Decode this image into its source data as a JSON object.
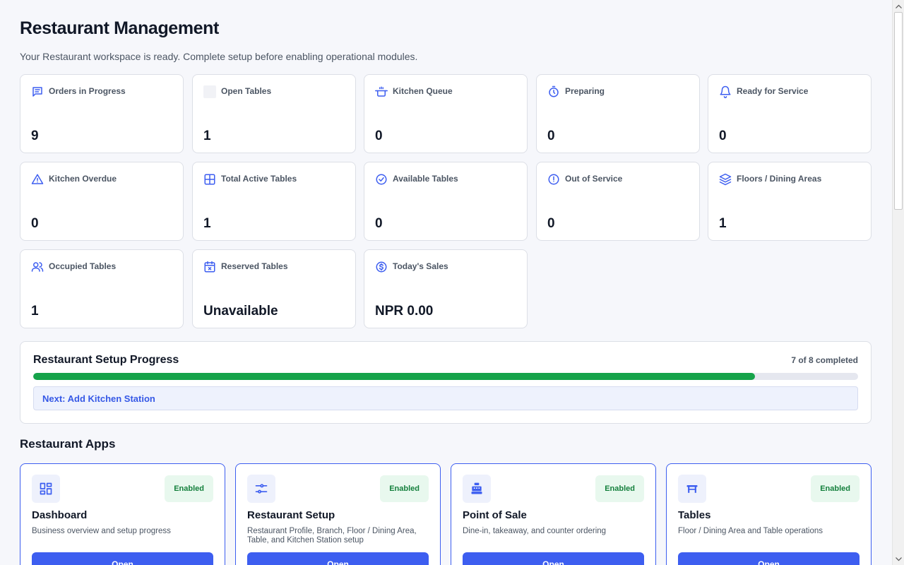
{
  "page": {
    "title": "Restaurant Management",
    "subtitle": "Your Restaurant workspace is ready. Complete setup before enabling operational modules."
  },
  "stats": [
    {
      "icon": "message-list-icon",
      "label": "Orders in Progress",
      "value": "9"
    },
    {
      "icon": "blank-icon",
      "label": "Open Tables",
      "value": "1"
    },
    {
      "icon": "cooking-pot-icon",
      "label": "Kitchen Queue",
      "value": "0"
    },
    {
      "icon": "stopwatch-icon",
      "label": "Preparing",
      "value": "0"
    },
    {
      "icon": "bell-icon",
      "label": "Ready for Service",
      "value": "0"
    },
    {
      "icon": "warning-triangle-icon",
      "label": "Kitchen Overdue",
      "value": "0"
    },
    {
      "icon": "grid-icon",
      "label": "Total Active Tables",
      "value": "1"
    },
    {
      "icon": "check-circle-icon",
      "label": "Available Tables",
      "value": "0"
    },
    {
      "icon": "alert-circle-icon",
      "label": "Out of Service",
      "value": "0"
    },
    {
      "icon": "layers-icon",
      "label": "Floors / Dining Areas",
      "value": "1"
    },
    {
      "icon": "users-icon",
      "label": "Occupied Tables",
      "value": "1"
    },
    {
      "icon": "calendar-x-icon",
      "label": "Reserved Tables",
      "value": "Unavailable"
    },
    {
      "icon": "dollar-circle-icon",
      "label": "Today's Sales",
      "value": "NPR 0.00"
    }
  ],
  "setup_progress": {
    "title": "Restaurant Setup Progress",
    "count_text": "7 of 8 completed",
    "completed": 7,
    "total": 8,
    "next_label": "Next: Add Kitchen Station"
  },
  "apps_section": {
    "title": "Restaurant Apps",
    "apps": [
      {
        "icon": "dashboard-icon",
        "name": "Dashboard",
        "badge": "Enabled",
        "description": "Business overview and setup progress",
        "button": "Open"
      },
      {
        "icon": "sliders-icon",
        "name": "Restaurant Setup",
        "badge": "Enabled",
        "description": "Restaurant Profile, Branch, Floor / Dining Area, Table, and Kitchen Station setup",
        "button": "Open"
      },
      {
        "icon": "cash-register-icon",
        "name": "Point of Sale",
        "badge": "Enabled",
        "description": "Dine-in, takeaway, and counter ordering",
        "button": "Open"
      },
      {
        "icon": "table-icon",
        "name": "Tables",
        "badge": "Enabled",
        "description": "Floor / Dining Area and Table operations",
        "button": "Open"
      }
    ]
  },
  "colors": {
    "accent": "#3d5ef0",
    "success": "#16a34a",
    "badge_bg": "#e8f8ee",
    "icon_blue": "#3d5ef0"
  }
}
